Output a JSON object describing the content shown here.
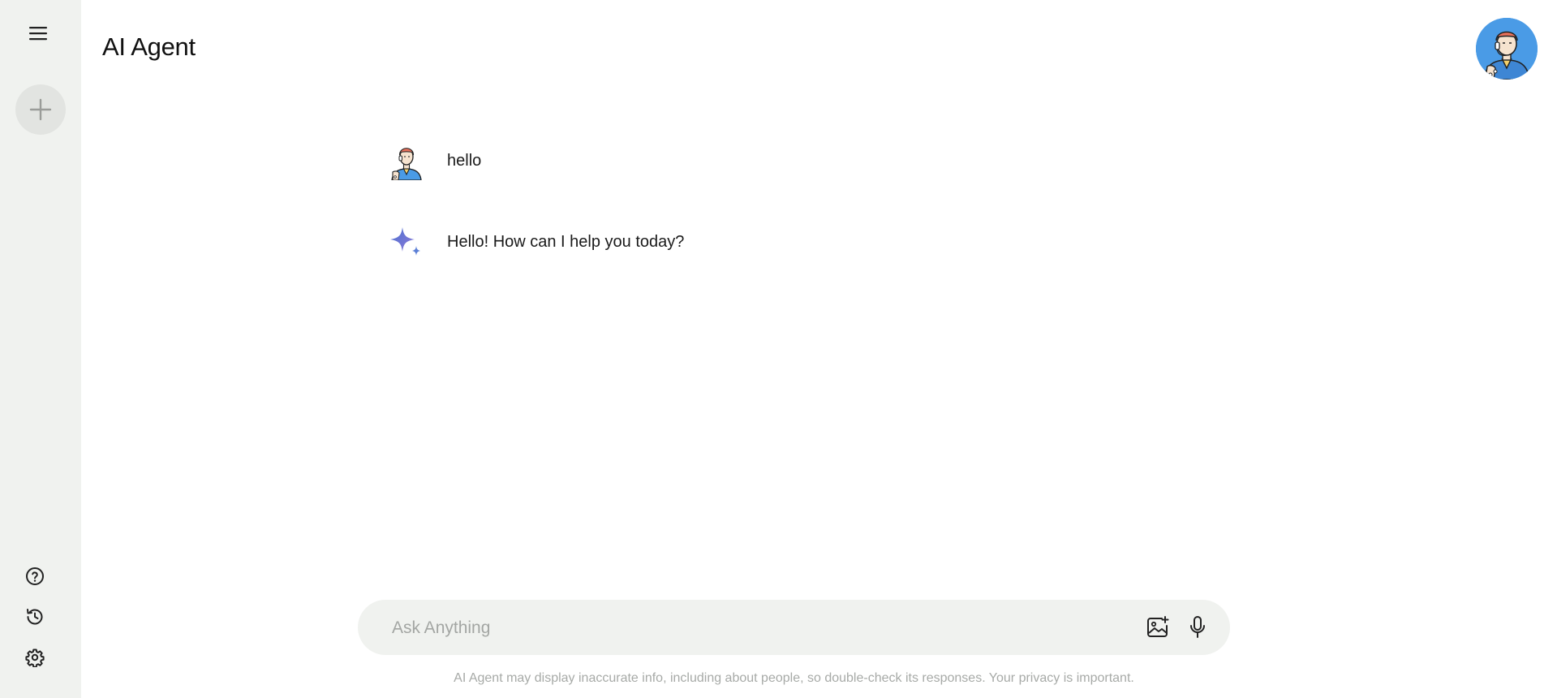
{
  "app": {
    "title": "AI Agent"
  },
  "sidebar": {
    "menu_icon": "hamburger-menu-icon",
    "new_chat_icon": "plus-icon",
    "bottom_items": [
      {
        "icon": "help-circle-icon"
      },
      {
        "icon": "history-icon"
      },
      {
        "icon": "gear-icon"
      }
    ]
  },
  "messages": [
    {
      "role": "user",
      "avatar": "user-avatar-icon",
      "text": "hello"
    },
    {
      "role": "assistant",
      "avatar": "sparkle-icon",
      "text": "Hello! How can I help you today?"
    }
  ],
  "composer": {
    "placeholder": "Ask Anything",
    "value": "",
    "image_icon": "image-upload-icon",
    "mic_icon": "microphone-icon"
  },
  "footer": {
    "disclaimer": "AI Agent may display inaccurate info, including about people, so double-check its responses. Your privacy is important."
  },
  "colors": {
    "sidebar_bg": "#f0f2ef",
    "input_bg": "#f0f2ef",
    "avatar_bg": "#4a9be6",
    "sparkle": "#5b7fd6",
    "hair": "#e8715c"
  }
}
